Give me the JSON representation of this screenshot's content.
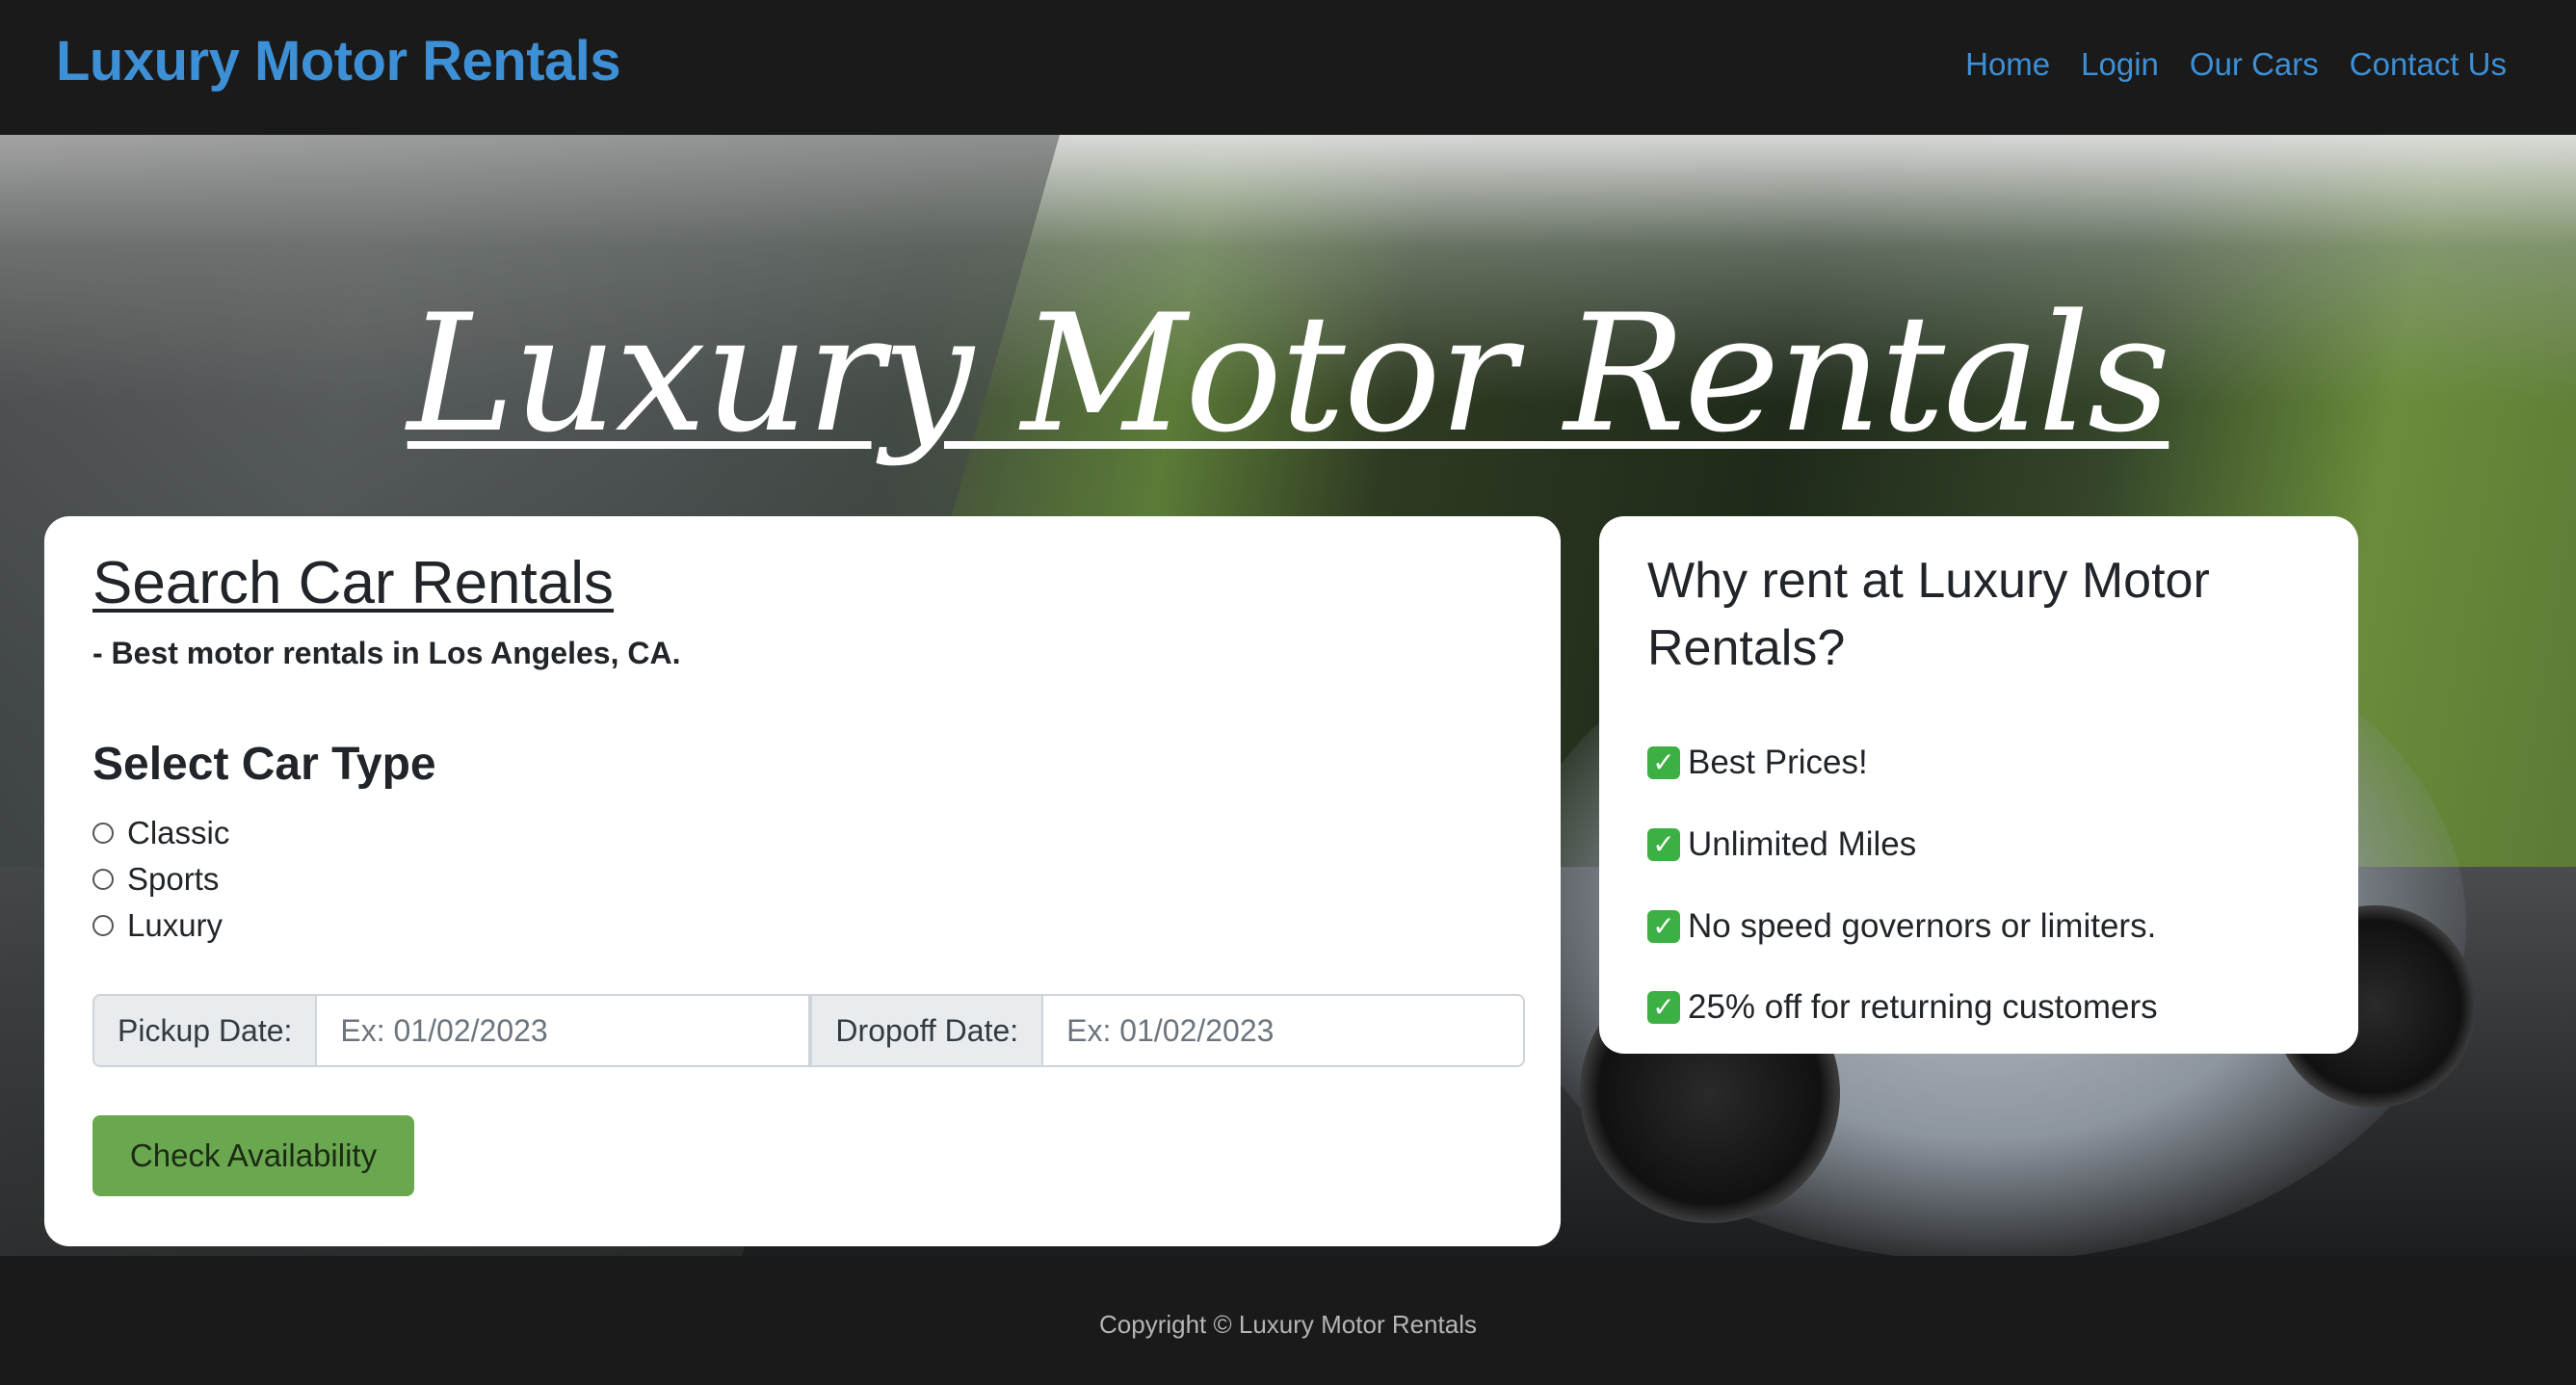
{
  "navbar": {
    "brand": "Luxury Motor Rentals",
    "links": [
      "Home",
      "Login",
      "Our Cars",
      "Contact Us"
    ]
  },
  "hero": {
    "title": "Luxury Motor Rentals"
  },
  "search": {
    "title": "Search Car Rentals",
    "subtitle": "- Best motor rentals in Los Angeles, CA.",
    "car_type_heading": "Select Car Type",
    "car_types": [
      "Classic",
      "Sports",
      "Luxury"
    ],
    "pickup_label": "Pickup Date:",
    "pickup_placeholder": "Ex: 01/02/2023",
    "dropoff_label": "Dropoff Date:",
    "dropoff_placeholder": "Ex: 01/02/2023",
    "button_label": "Check Availability"
  },
  "why": {
    "title": "Why rent at Luxury Motor Rentals?",
    "check_glyph": "✓",
    "items": [
      "Best Prices!",
      "Unlimited Miles",
      "No speed governors or limiters.",
      "25% off for returning customers"
    ]
  },
  "footer": {
    "copyright": "Copyright © Luxury Motor Rentals"
  },
  "colors": {
    "nav_background": "#1a1a1a",
    "link_blue": "#3d8fd6",
    "button_green": "#6aa84f",
    "check_green": "#3cb043"
  }
}
